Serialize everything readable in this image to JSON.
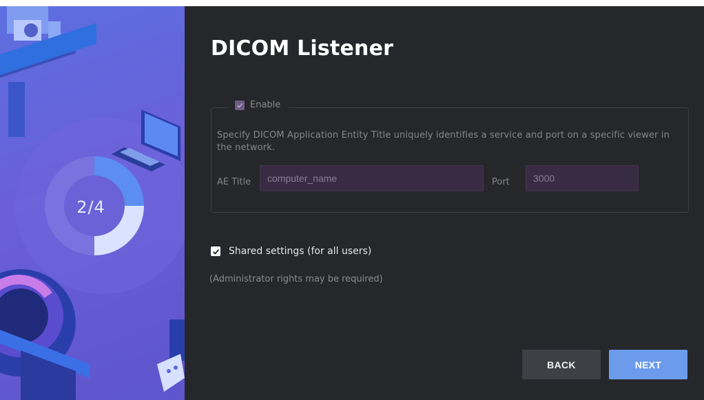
{
  "wizard": {
    "step_indicator": "2/4",
    "step_progress": 0.5,
    "title": "DICOM Listener"
  },
  "listener_group": {
    "enable_label": "Enable",
    "enable_checked": true,
    "description": "Specify DICOM Application Entity Title uniquely identifies a service and port on a specific viewer in the network.",
    "ae_title_label": "AE Title",
    "ae_title_value": "computer_name",
    "port_label": "Port",
    "port_value": "3000"
  },
  "shared_settings": {
    "label": "Shared settings (for all users)",
    "checked": true,
    "note": "(Administrator rights may be required)"
  },
  "buttons": {
    "back_label": "BACK",
    "next_label": "NEXT"
  },
  "colors": {
    "panel_bg": "#25272a",
    "accent": "#6b9bea",
    "side_panel": "#6a5fd8"
  }
}
